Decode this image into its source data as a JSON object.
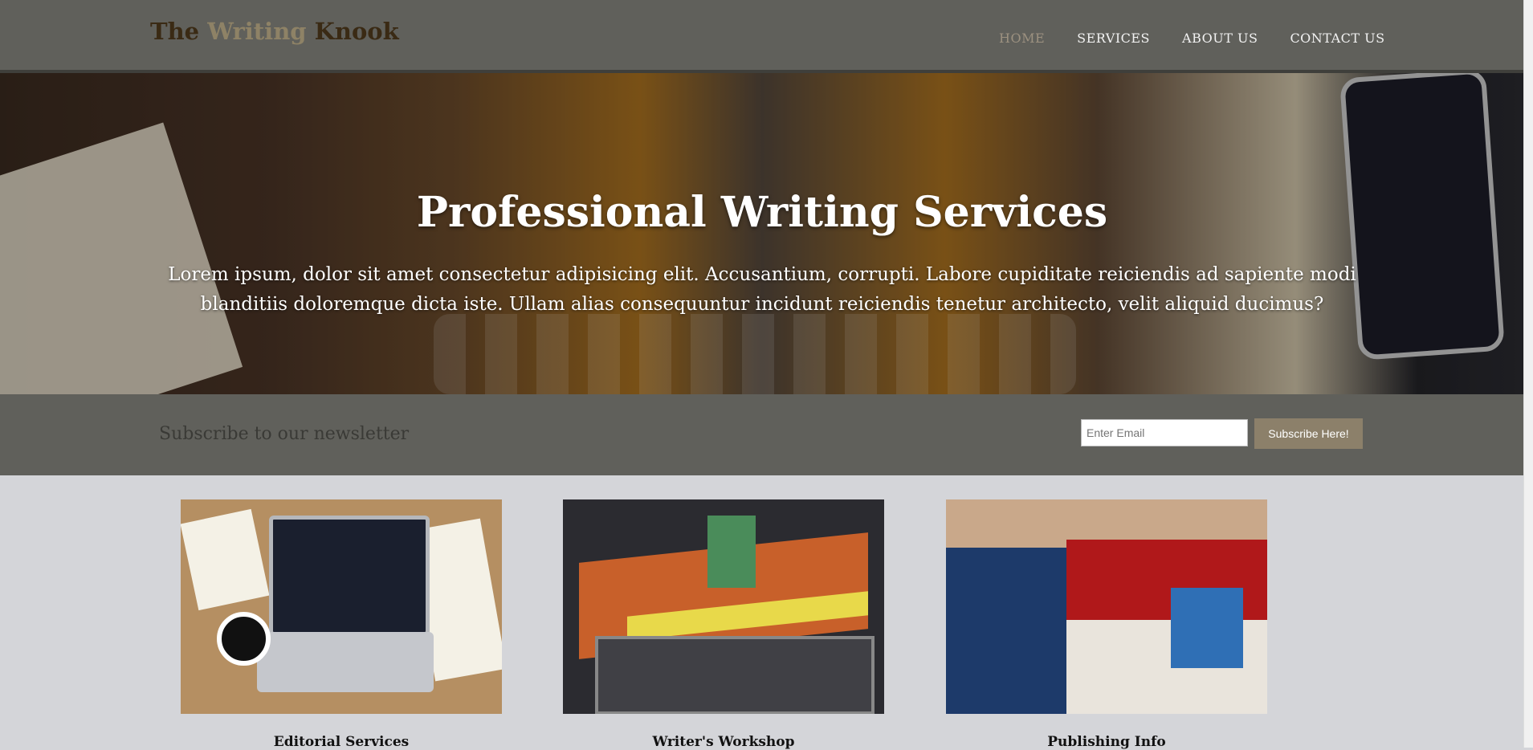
{
  "header": {
    "logo": {
      "part1": "The ",
      "part2": "Writing",
      "part3": " Knook"
    },
    "nav": [
      {
        "label": "HOME",
        "active": true
      },
      {
        "label": "SERVICES",
        "active": false
      },
      {
        "label": "ABOUT US",
        "active": false
      },
      {
        "label": "CONTACT US",
        "active": false
      }
    ]
  },
  "hero": {
    "title": "Professional Writing Services",
    "text": "Lorem ipsum, dolor sit amet consectetur adipisicing elit. Accusantium, corrupti. Labore cupiditate reiciendis ad sapiente modi blanditiis doloremque dicta iste. Ullam alias consequuntur incidunt reiciendis tenetur architecto, velit aliquid ducimus?"
  },
  "newsletter": {
    "heading": "Subscribe to our newsletter",
    "email_placeholder": "Enter Email",
    "button_label": "Subscribe Here!"
  },
  "cards": [
    {
      "title": "Editorial Services"
    },
    {
      "title": "Writer's Workshop"
    },
    {
      "title": "Publishing Info"
    }
  ],
  "colors": {
    "header_bg": "#60605b",
    "accent": "#8c806a",
    "page_bg": "#d4d5d9"
  }
}
